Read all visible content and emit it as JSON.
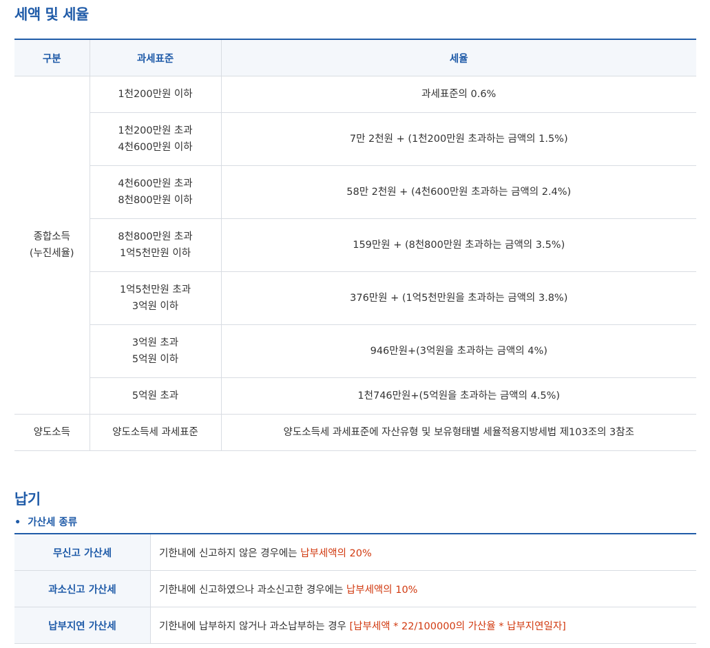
{
  "section1": {
    "title": "세액 및 세율",
    "headers": [
      "구분",
      "과세표준",
      "세율"
    ],
    "group1": {
      "label_line1": "종합소득",
      "label_line2": "(누진세율)"
    },
    "rows": [
      {
        "base_line1": "1천200만원 이하",
        "base_line2": "",
        "rate": "과세표준의 0.6%"
      },
      {
        "base_line1": "1천200만원 초과",
        "base_line2": "4천600만원 이하",
        "rate": "7만 2천원 + (1천200만원 초과하는 금액의 1.5%)"
      },
      {
        "base_line1": "4천600만원 초과",
        "base_line2": "8천800만원 이하",
        "rate": "58만 2천원 + (4천600만원 초과하는 금액의 2.4%)"
      },
      {
        "base_line1": "8천800만원 초과",
        "base_line2": "1억5천만원 이하",
        "rate": "159만원 + (8천800만원 초과하는 금액의 3.5%)"
      },
      {
        "base_line1": "1억5천만원 초과",
        "base_line2": "3억원 이하",
        "rate": "376만원 + (1억5천만원을 초과하는 금액의 3.8%)"
      },
      {
        "base_line1": "3억원 초과",
        "base_line2": "5억원 이하",
        "rate": "946만원+(3억원을 초과하는 금액의 4%)"
      },
      {
        "base_line1": "5억원 초과",
        "base_line2": "",
        "rate": "1천746만원+(5억원을 초과하는 금액의 4.5%)"
      }
    ],
    "group2": {
      "label": "양도소득",
      "base": "양도소득세 과세표준",
      "rate": "양도소득세 과세표준에 자산유형 및 보유형태별 세율적용지방세법 제103조의 3참조"
    }
  },
  "section2": {
    "title": "납기",
    "bullet": "•",
    "subtitle": "가산세 종류",
    "rows": [
      {
        "name": "무신고 가산세",
        "text": "기한내에 신고하지 않은 경우에는 ",
        "highlight": "납부세액의 20%"
      },
      {
        "name": "과소신고 가산세",
        "text": "기한내에 신고하였으나 과소신고한 경우에는 ",
        "highlight": "납부세액의 10%"
      },
      {
        "name": "납부지연 가산세",
        "text": "기한내에 납부하지 않거나 과소납부하는 경우 ",
        "highlight": "[납부세액 * 22/100000의 가산율 * 납부지연일자]"
      }
    ]
  },
  "colors": {
    "accent": "#1f5ba8",
    "highlight": "#d1390f",
    "header_bg": "#f4f7fb",
    "border": "#d8dce2"
  }
}
